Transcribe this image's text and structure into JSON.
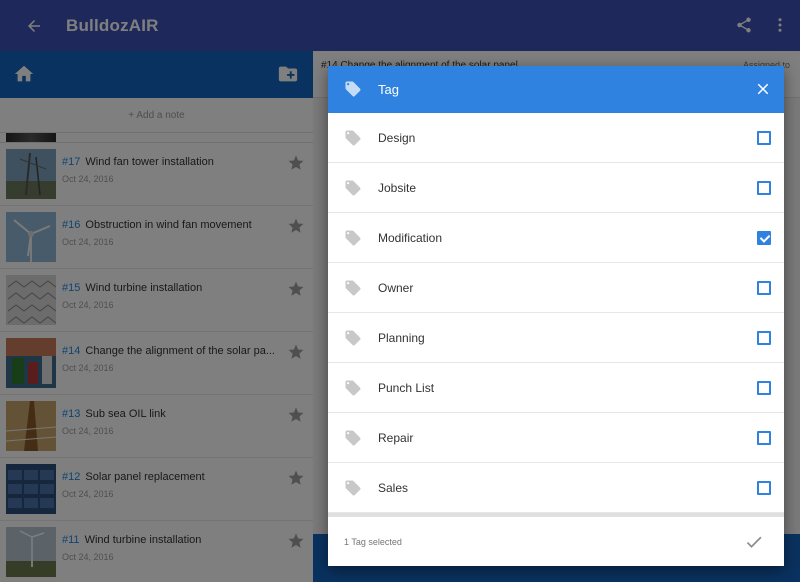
{
  "appbar": {
    "title": "BulldozAIR",
    "back_icon": "arrow-back-icon",
    "share_icon": "share-icon",
    "menu_icon": "more-vert-icon"
  },
  "left_panel": {
    "add_note": "+ Add a note",
    "items": [
      {
        "num": "#17",
        "title": "Wind fan tower installation",
        "date": "Oct 24, 2016"
      },
      {
        "num": "#16",
        "title": "Obstruction in wind fan movement",
        "date": "Oct 24, 2016"
      },
      {
        "num": "#15",
        "title": "Wind turbine installation",
        "date": "Oct 24, 2016"
      },
      {
        "num": "#14",
        "title": "Change the alignment of the solar pa...",
        "date": "Oct 24, 2016"
      },
      {
        "num": "#13",
        "title": "Sub sea OIL link",
        "date": "Oct 24, 2016"
      },
      {
        "num": "#12",
        "title": "Solar panel replacement",
        "date": "Oct 24, 2016"
      },
      {
        "num": "#11",
        "title": "Wind turbine installation",
        "date": "Oct 24, 2016"
      }
    ]
  },
  "right_panel": {
    "title": "#14 Change the alignment of the solar panel",
    "assigned": "Assigned to"
  },
  "dialog": {
    "title": "Tag",
    "options": [
      {
        "label": "Design",
        "checked": false
      },
      {
        "label": "Jobsite",
        "checked": false
      },
      {
        "label": "Modification",
        "checked": true
      },
      {
        "label": "Owner",
        "checked": false
      },
      {
        "label": "Planning",
        "checked": false
      },
      {
        "label": "Punch List",
        "checked": false
      },
      {
        "label": "Repair",
        "checked": false
      },
      {
        "label": "Sales",
        "checked": false
      }
    ],
    "footer_text": "1 Tag selected"
  },
  "colors": {
    "appbar": "#3f51b5",
    "left_toolbar": "#1565c0",
    "dialog_header": "#2f82e0",
    "accent": "#1e88e5"
  }
}
